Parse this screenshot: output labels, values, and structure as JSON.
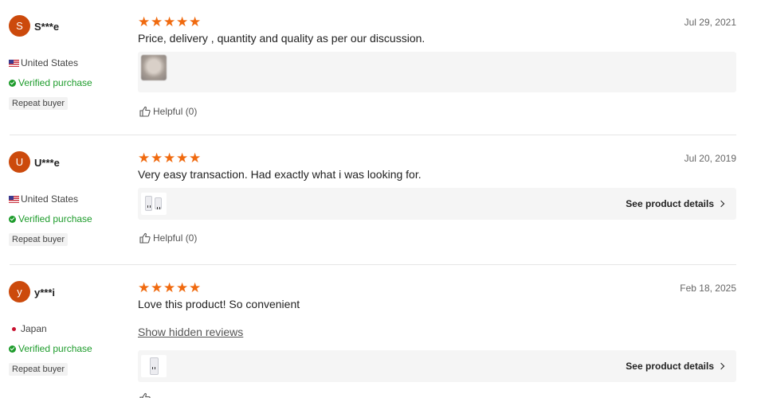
{
  "reviews": [
    {
      "avatar_letter": "S",
      "username": "S***e",
      "country": "United States",
      "verified": "Verified purchase",
      "repeat": "Repeat buyer",
      "date": "Jul 29, 2021",
      "text": "Price, delivery , quantity and quality as per our discussion.",
      "helpful": "Helpful (0)"
    },
    {
      "avatar_letter": "U",
      "username": "U***e",
      "country": "United States",
      "verified": "Verified purchase",
      "repeat": "Repeat buyer",
      "date": "Jul 20, 2019",
      "text": "Very easy transaction. Had exactly what i was looking for.",
      "see_details": "See product details",
      "helpful": "Helpful (0)"
    },
    {
      "avatar_letter": "y",
      "username": "y***i",
      "country": "Japan",
      "verified": "Verified purchase",
      "repeat": "Repeat buyer",
      "date": "Feb 18, 2025",
      "text": "Love this product! So convenient",
      "hidden_link": "Show hidden reviews",
      "see_details": "See product details"
    }
  ],
  "rating_stars": 5,
  "colors": {
    "accent": "#f06a0f",
    "avatar": "#cc4a0c",
    "verified": "#1e9c2c"
  }
}
